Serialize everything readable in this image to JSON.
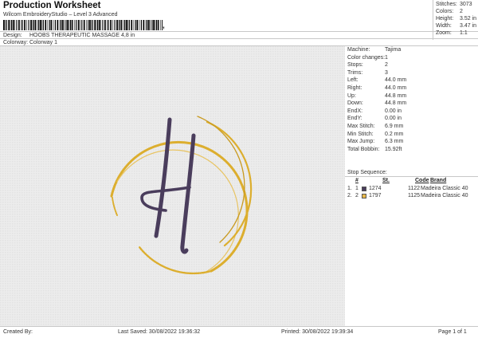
{
  "header": {
    "title": "Production Worksheet",
    "subtitle": "Wilcom EmbroideryStudio – Level 3 Advanced",
    "barcode_suffix": ",",
    "design_label": "Design:",
    "design_value": "HOOBS THERAPEUTIC MASSAGE 4,8 in",
    "colorway_label": "Colorway:",
    "colorway_value": "Colorway 1"
  },
  "stats": {
    "stitches_label": "Stitches:",
    "stitches_value": "3073",
    "colors_label": "Colors:",
    "colors_value": "2",
    "height_label": "Height:",
    "height_value": "3.52 in",
    "width_label": "Width:",
    "width_value": "3.47 in",
    "zoom_label": "Zoom:",
    "zoom_value": "1:1"
  },
  "properties": [
    {
      "label": "Machine:",
      "value": "Tajima"
    },
    {
      "label": "Color changes:",
      "value": "1"
    },
    {
      "label": "Stops:",
      "value": "2"
    },
    {
      "label": "Trims:",
      "value": "3"
    },
    {
      "label": "Left:",
      "value": "44.0 mm"
    },
    {
      "label": "Right:",
      "value": "44.0 mm"
    },
    {
      "label": "Up:",
      "value": "44.8 mm"
    },
    {
      "label": "Down:",
      "value": "44.8 mm"
    },
    {
      "label": "EndX:",
      "value": "0.00 in"
    },
    {
      "label": "EndY:",
      "value": "0.00 in"
    },
    {
      "label": "Max Stitch:",
      "value": "6.9 mm"
    },
    {
      "label": "Min Stitch:",
      "value": "0.2 mm"
    },
    {
      "label": "Max Jump:",
      "value": "6.3 mm"
    },
    {
      "label": "Total Bobbin:",
      "value": "15.92ft"
    }
  ],
  "stop_sequence": {
    "title": "Stop Sequence:",
    "headers": {
      "n": "#",
      "st": "St.",
      "code": "Code",
      "brand": "Brand"
    },
    "rows": [
      {
        "idx": "1.",
        "n": "1",
        "color": "#4a3d5c",
        "st": "1274",
        "code": "1122",
        "brand": "Madeira Classic 40"
      },
      {
        "idx": "2.",
        "n": "2",
        "color": "#e8b84a",
        "st": "1797",
        "code": "1125",
        "brand": "Madeira Classic 40"
      }
    ]
  },
  "colors": {
    "thread_purple": "#4a3d5c",
    "thread_gold": "#dcae2e",
    "background": "#ececec"
  },
  "footer": {
    "created_by": "Created By:",
    "last_saved": "Last Saved: 30/08/2022 19:36:32",
    "printed": "Printed: 30/08/2022 19:39:34",
    "page": "Page 1 of 1"
  }
}
